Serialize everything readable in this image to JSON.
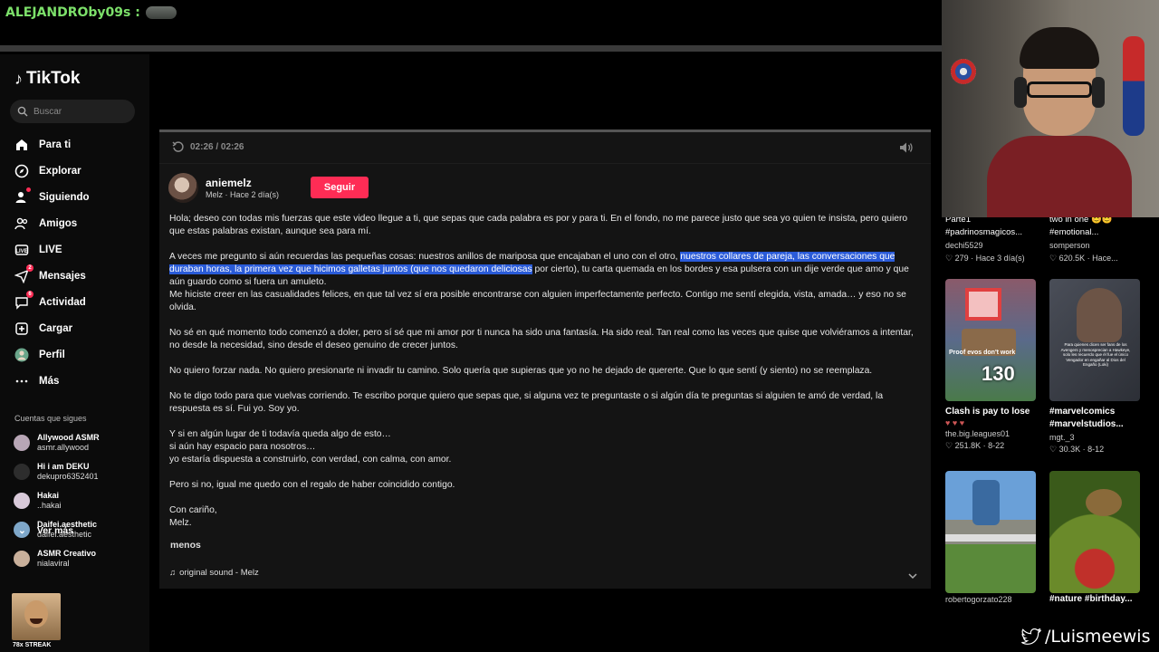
{
  "chat": {
    "username": "ALEJANDROby09s :"
  },
  "sidebar": {
    "logo": "TikTok",
    "search_placeholder": "Buscar",
    "nav": [
      {
        "label": "Para ti"
      },
      {
        "label": "Explorar"
      },
      {
        "label": "Siguiendo"
      },
      {
        "label": "Amigos"
      },
      {
        "label": "LIVE"
      },
      {
        "label": "Mensajes",
        "badge": "2"
      },
      {
        "label": "Actividad",
        "badge": "6"
      },
      {
        "label": "Cargar"
      },
      {
        "label": "Perfil"
      },
      {
        "label": "Más"
      }
    ],
    "following_title": "Cuentas que sigues",
    "accounts": [
      {
        "name": "Allywood ASMR",
        "handle": "asmr.allywood"
      },
      {
        "name": "Hi i am DEKU",
        "handle": "dekupro6352401"
      },
      {
        "name": "Hakai",
        "handle": "..hakai"
      },
      {
        "name": "Daifei.aesthetic",
        "handle": "daifei.aesthetic"
      },
      {
        "name": "ASMR Creativo",
        "handle": "nialaviral"
      }
    ],
    "see_more": "Ver más",
    "streak": "78x STREAK"
  },
  "player": {
    "time": "02:26 / 02:26"
  },
  "post": {
    "author": "aniemelz",
    "meta": "Melz · Hace 2 día(s)",
    "follow": "Seguir",
    "p1": "Hola; deseo con todas mis fuerzas que este video llegue a ti, que sepas que cada palabra es por y para ti. En el fondo, no me parece justo que sea yo quien te insista, pero quiero que estas palabras existan, aunque sea para mí.",
    "p2a": "A veces me pregunto si aún recuerdas las pequeñas cosas: nuestros anillos de mariposa que encajaban el uno con el otro, ",
    "p2hl": "nuestros collares de pareja, las conversaciones que duraban horas, la primera vez que hicimos galletas juntos (que nos quedaron deliciosas",
    "p2b": " por cierto), tu carta quemada en los bordes y esa pulsera con un dije verde que amo y que aún guardo como si fuera un amuleto.",
    "p3": "Me hiciste creer en las casualidades felices, en que tal vez sí era posible encontrarse con alguien imperfectamente perfecto. Contigo me sentí elegida, vista, amada… y eso no se olvida.",
    "p4": "No sé en qué momento todo comenzó a doler, pero sí sé que mi amor por ti nunca ha sido una fantasía. Ha sido real. Tan real como las veces que quise que volviéramos a intentar, no desde la necesidad, sino desde el deseo genuino de crecer juntos.",
    "p5": "No quiero forzar nada. No quiero presionarte ni invadir tu camino. Solo quería que supieras que yo no he dejado de quererte. Que lo que sentí (y siento) no se reemplaza.",
    "p6": "No te digo todo para que vuelvas corriendo. Te escribo porque quiero que sepas que, si alguna vez te preguntaste o si algún día te preguntas si alguien te amó de verdad, la respuesta es sí. Fui yo. Soy yo.",
    "p7": "Y si en algún lugar de ti todavía queda algo de esto…\nsi aún hay espacio para nosotros…\nyo estaría dispuesta a construirlo, con verdad, con calma, con amor.",
    "p8": "Pero si no, igual me quedo con el regalo de haber coincidido contigo.",
    "p9": "Con cariño,\nMelz.",
    "less": "menos",
    "sound": "original sound - Melz"
  },
  "grid": {
    "top": [
      {
        "title1": "Parte1",
        "title2": "#padrinosmagicos...",
        "user": "dechi5529",
        "stats": "279 · Hace 3 día(s)"
      },
      {
        "title1": "two in one",
        "title2": "#emotional...",
        "user": "somperson",
        "stats": "620.5K · Hace..."
      }
    ],
    "cards": [
      {
        "overlay": "Proof evos don't work",
        "overlay2": "130",
        "title": "Clash is pay to lose",
        "title2": "",
        "user": "the.big.leagues01",
        "stats": "251.8K · 8-22"
      },
      {
        "overlay": "Para quienes dicen ser fans de los Avengers y menosprecian a Hawkeye, solo les recuerdo que él fue el único Vengador en engañar al Dios del Engaño (Loki)",
        "title": "#marvelcomics",
        "title2": "#marvelstudios...",
        "user": "mgt._3",
        "stats": "30.3K · 8-12"
      },
      {
        "user": "robertogorzato228"
      },
      {
        "title": "#nature #birthday..."
      }
    ]
  },
  "twitter_handle": "/Luismeewis"
}
